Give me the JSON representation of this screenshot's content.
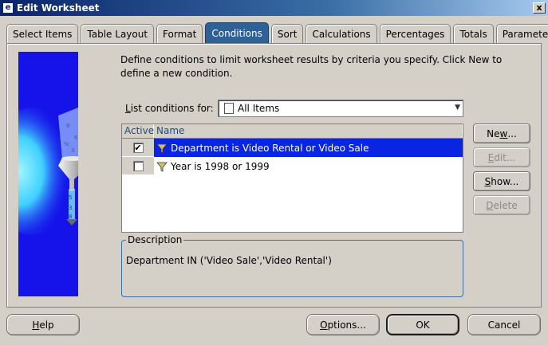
{
  "window": {
    "title": "Edit Worksheet",
    "close_glyph": "x"
  },
  "tabs": [
    {
      "label": "Select Items"
    },
    {
      "label": "Table Layout"
    },
    {
      "label": "Format"
    },
    {
      "label": "Conditions",
      "active": true
    },
    {
      "label": "Sort"
    },
    {
      "label": "Calculations"
    },
    {
      "label": "Percentages"
    },
    {
      "label": "Totals"
    },
    {
      "label": "Parameters"
    }
  ],
  "conditions": {
    "intro": "Define conditions to limit worksheet results by criteria you specify. Click New to define a new condition.",
    "list_label_prefix": "",
    "list_label_accel": "L",
    "list_label_rest": "ist conditions for:",
    "list_for_value": "All Items",
    "columns": {
      "active": "Active",
      "name": "Name"
    },
    "rows": [
      {
        "active": true,
        "checkmark": "✔",
        "name": "Department is Video Rental or Video Sale",
        "selected": true
      },
      {
        "active": false,
        "checkmark": "",
        "name": "Year is 1998 or 1999",
        "selected": false
      }
    ],
    "description_legend": "Description",
    "description_text": "Department IN ('Video Sale','Video Rental')"
  },
  "side_buttons": {
    "new": {
      "pre": "Ne",
      "accel": "w",
      "post": "..."
    },
    "edit": {
      "pre": "",
      "accel": "E",
      "post": "dit..."
    },
    "show": {
      "pre": "",
      "accel": "S",
      "post": "how..."
    },
    "delete": {
      "pre": "",
      "accel": "D",
      "post": "elete"
    }
  },
  "bottom_buttons": {
    "help": {
      "pre": "",
      "accel": "H",
      "post": "elp"
    },
    "options": {
      "pre": "",
      "accel": "O",
      "post": "ptions..."
    },
    "ok": "OK",
    "cancel": "Cancel"
  },
  "colors": {
    "active_tab": "#2f6199",
    "selected_row": "#0a24e4",
    "art_background": "#1512ea"
  }
}
